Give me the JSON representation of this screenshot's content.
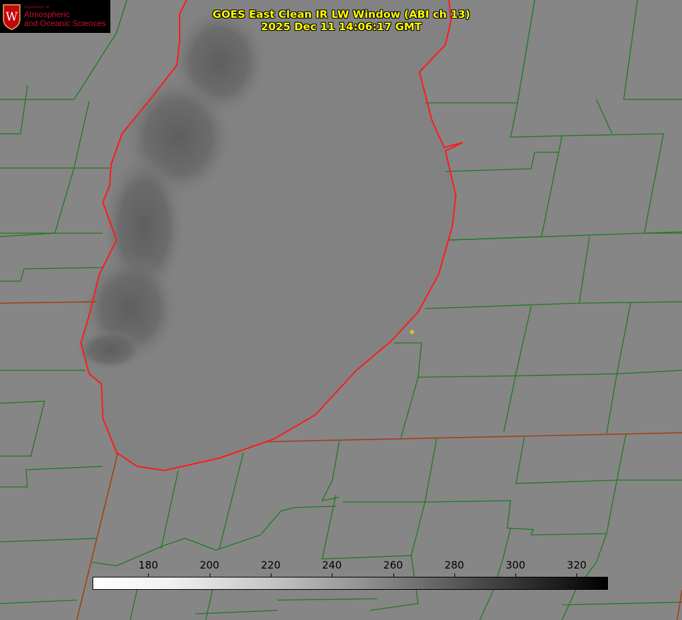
{
  "logo": {
    "dept": "Department of",
    "line1": "Atmospheric",
    "line2": "and Oceanic Sciences",
    "crest_letter": "W"
  },
  "title": {
    "line1": "GOES East Clean IR LW Window (ABI ch 13)",
    "line2": "2025 Dec 11 14:06:17 GMT"
  },
  "colorbar": {
    "min": 162,
    "max": 330,
    "ticks": [
      "180",
      "200",
      "220",
      "240",
      "260",
      "280",
      "300",
      "320"
    ],
    "tick_values": [
      180,
      200,
      220,
      240,
      260,
      280,
      300,
      320
    ]
  },
  "colors": {
    "county_lines": "#1e7a1e",
    "lake_outline": "#ff1a1a",
    "title_text": "#ffff00",
    "marker": "#d4c81a"
  }
}
